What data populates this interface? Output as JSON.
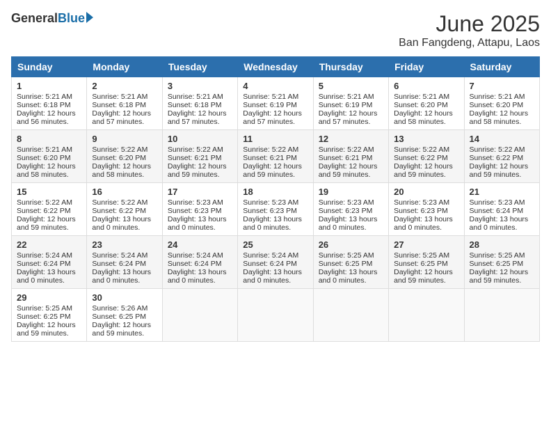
{
  "header": {
    "logo_general": "General",
    "logo_blue": "Blue",
    "title": "June 2025",
    "subtitle": "Ban Fangdeng, Attapu, Laos"
  },
  "weekdays": [
    "Sunday",
    "Monday",
    "Tuesday",
    "Wednesday",
    "Thursday",
    "Friday",
    "Saturday"
  ],
  "weeks": [
    [
      {
        "day": "1",
        "sunrise": "5:21 AM",
        "sunset": "6:18 PM",
        "daylight": "12 hours and 56 minutes."
      },
      {
        "day": "2",
        "sunrise": "5:21 AM",
        "sunset": "6:18 PM",
        "daylight": "12 hours and 57 minutes."
      },
      {
        "day": "3",
        "sunrise": "5:21 AM",
        "sunset": "6:18 PM",
        "daylight": "12 hours and 57 minutes."
      },
      {
        "day": "4",
        "sunrise": "5:21 AM",
        "sunset": "6:19 PM",
        "daylight": "12 hours and 57 minutes."
      },
      {
        "day": "5",
        "sunrise": "5:21 AM",
        "sunset": "6:19 PM",
        "daylight": "12 hours and 57 minutes."
      },
      {
        "day": "6",
        "sunrise": "5:21 AM",
        "sunset": "6:20 PM",
        "daylight": "12 hours and 58 minutes."
      },
      {
        "day": "7",
        "sunrise": "5:21 AM",
        "sunset": "6:20 PM",
        "daylight": "12 hours and 58 minutes."
      }
    ],
    [
      {
        "day": "8",
        "sunrise": "5:21 AM",
        "sunset": "6:20 PM",
        "daylight": "12 hours and 58 minutes."
      },
      {
        "day": "9",
        "sunrise": "5:22 AM",
        "sunset": "6:20 PM",
        "daylight": "12 hours and 58 minutes."
      },
      {
        "day": "10",
        "sunrise": "5:22 AM",
        "sunset": "6:21 PM",
        "daylight": "12 hours and 59 minutes."
      },
      {
        "day": "11",
        "sunrise": "5:22 AM",
        "sunset": "6:21 PM",
        "daylight": "12 hours and 59 minutes."
      },
      {
        "day": "12",
        "sunrise": "5:22 AM",
        "sunset": "6:21 PM",
        "daylight": "12 hours and 59 minutes."
      },
      {
        "day": "13",
        "sunrise": "5:22 AM",
        "sunset": "6:22 PM",
        "daylight": "12 hours and 59 minutes."
      },
      {
        "day": "14",
        "sunrise": "5:22 AM",
        "sunset": "6:22 PM",
        "daylight": "12 hours and 59 minutes."
      }
    ],
    [
      {
        "day": "15",
        "sunrise": "5:22 AM",
        "sunset": "6:22 PM",
        "daylight": "12 hours and 59 minutes."
      },
      {
        "day": "16",
        "sunrise": "5:22 AM",
        "sunset": "6:22 PM",
        "daylight": "13 hours and 0 minutes."
      },
      {
        "day": "17",
        "sunrise": "5:23 AM",
        "sunset": "6:23 PM",
        "daylight": "13 hours and 0 minutes."
      },
      {
        "day": "18",
        "sunrise": "5:23 AM",
        "sunset": "6:23 PM",
        "daylight": "13 hours and 0 minutes."
      },
      {
        "day": "19",
        "sunrise": "5:23 AM",
        "sunset": "6:23 PM",
        "daylight": "13 hours and 0 minutes."
      },
      {
        "day": "20",
        "sunrise": "5:23 AM",
        "sunset": "6:23 PM",
        "daylight": "13 hours and 0 minutes."
      },
      {
        "day": "21",
        "sunrise": "5:23 AM",
        "sunset": "6:24 PM",
        "daylight": "13 hours and 0 minutes."
      }
    ],
    [
      {
        "day": "22",
        "sunrise": "5:24 AM",
        "sunset": "6:24 PM",
        "daylight": "13 hours and 0 minutes."
      },
      {
        "day": "23",
        "sunrise": "5:24 AM",
        "sunset": "6:24 PM",
        "daylight": "13 hours and 0 minutes."
      },
      {
        "day": "24",
        "sunrise": "5:24 AM",
        "sunset": "6:24 PM",
        "daylight": "13 hours and 0 minutes."
      },
      {
        "day": "25",
        "sunrise": "5:24 AM",
        "sunset": "6:24 PM",
        "daylight": "13 hours and 0 minutes."
      },
      {
        "day": "26",
        "sunrise": "5:25 AM",
        "sunset": "6:25 PM",
        "daylight": "13 hours and 0 minutes."
      },
      {
        "day": "27",
        "sunrise": "5:25 AM",
        "sunset": "6:25 PM",
        "daylight": "12 hours and 59 minutes."
      },
      {
        "day": "28",
        "sunrise": "5:25 AM",
        "sunset": "6:25 PM",
        "daylight": "12 hours and 59 minutes."
      }
    ],
    [
      {
        "day": "29",
        "sunrise": "5:25 AM",
        "sunset": "6:25 PM",
        "daylight": "12 hours and 59 minutes."
      },
      {
        "day": "30",
        "sunrise": "5:26 AM",
        "sunset": "6:25 PM",
        "daylight": "12 hours and 59 minutes."
      },
      null,
      null,
      null,
      null,
      null
    ]
  ]
}
